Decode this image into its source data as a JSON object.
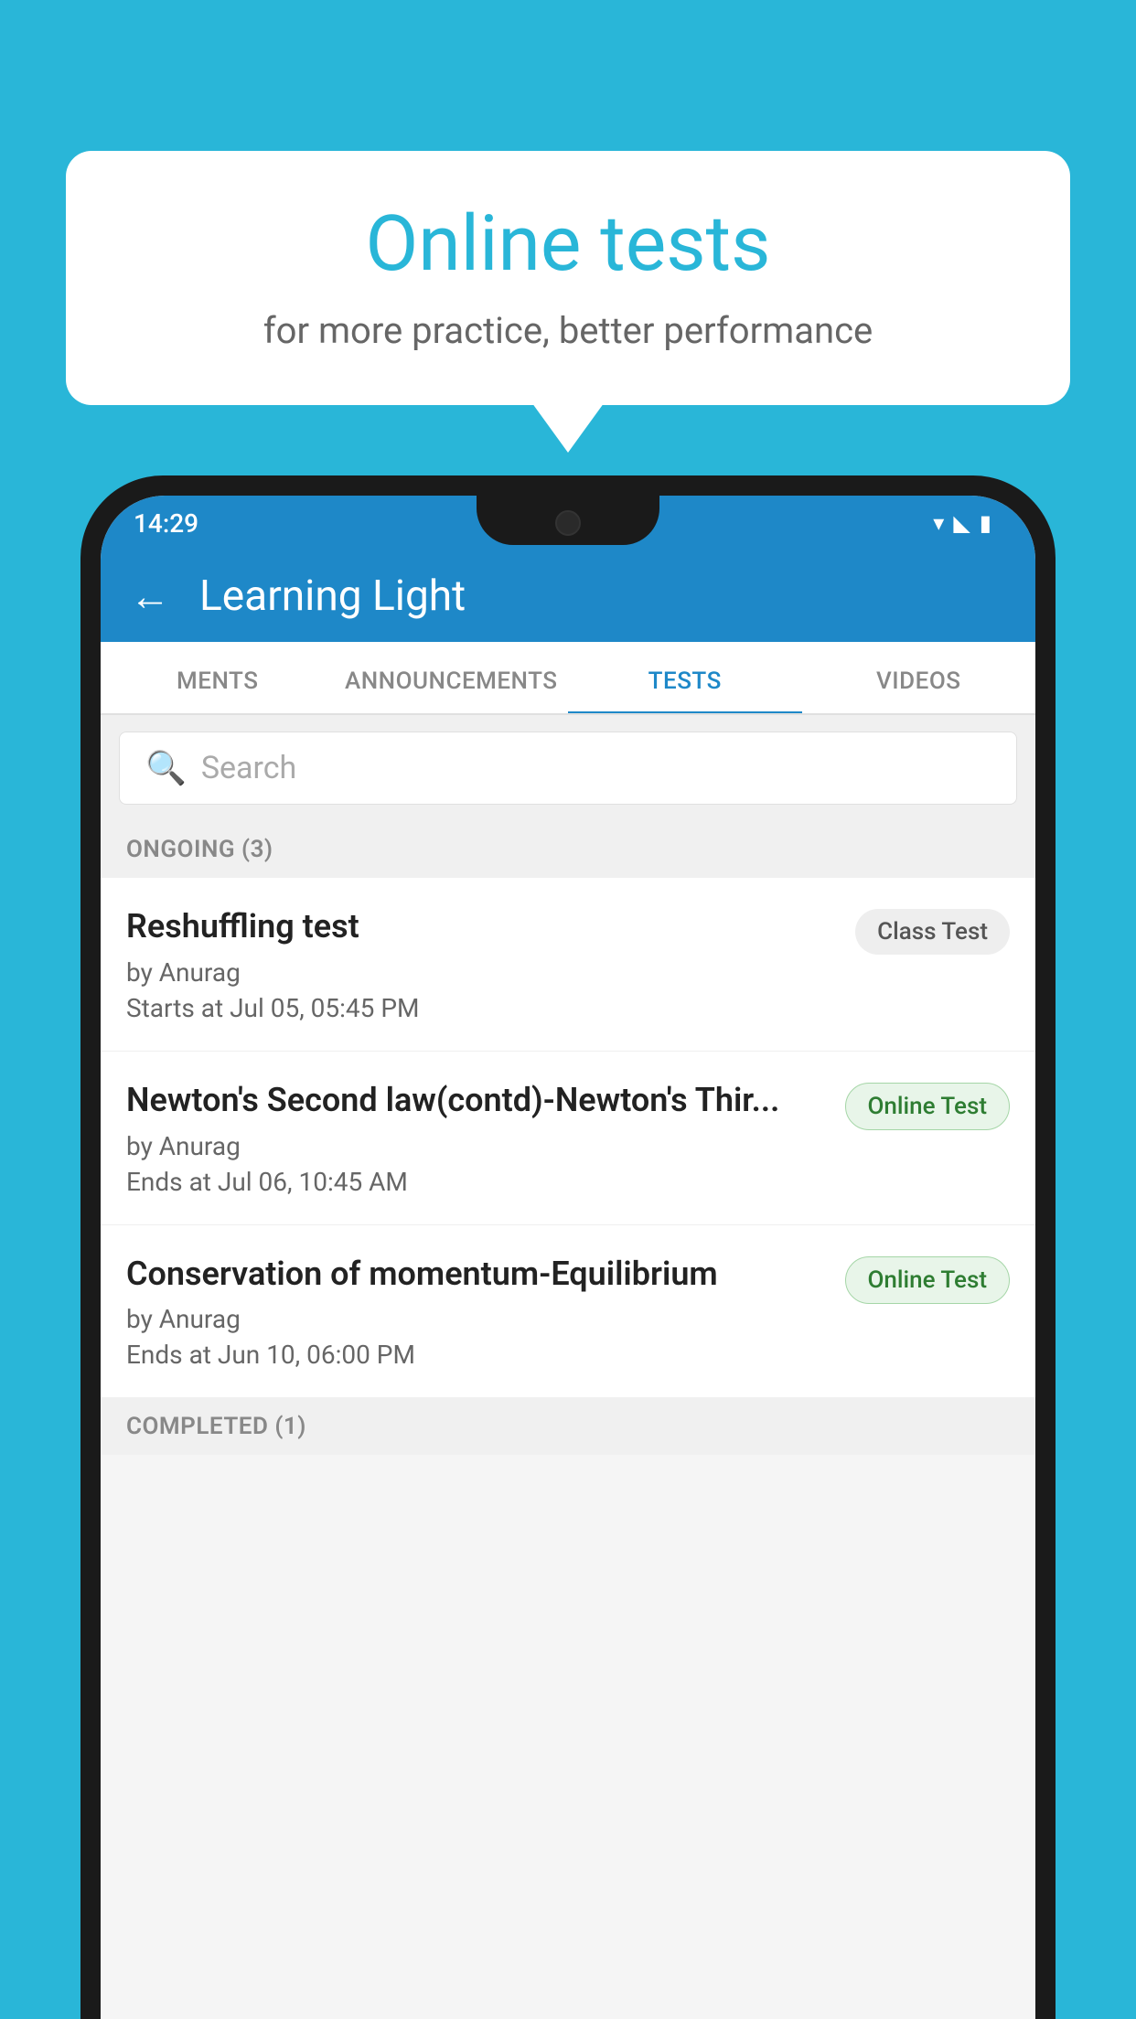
{
  "background": {
    "color": "#29b6d8"
  },
  "bubble": {
    "title": "Online tests",
    "subtitle": "for more practice, better performance"
  },
  "statusBar": {
    "time": "14:29",
    "wifi_icon": "▾",
    "signal_icon": "▴▴",
    "battery_icon": "▮"
  },
  "appBar": {
    "back_label": "←",
    "title": "Learning Light"
  },
  "tabs": [
    {
      "label": "MENTS",
      "active": false
    },
    {
      "label": "ANNOUNCEMENTS",
      "active": false
    },
    {
      "label": "TESTS",
      "active": true
    },
    {
      "label": "VIDEOS",
      "active": false
    }
  ],
  "search": {
    "placeholder": "Search"
  },
  "sections": {
    "ongoing": {
      "label": "ONGOING (3)",
      "tests": [
        {
          "name": "Reshuffling test",
          "author": "by Anurag",
          "time": "Starts at  Jul 05, 05:45 PM",
          "badge": "Class Test",
          "badge_type": "class"
        },
        {
          "name": "Newton's Second law(contd)-Newton's Thir...",
          "author": "by Anurag",
          "time": "Ends at  Jul 06, 10:45 AM",
          "badge": "Online Test",
          "badge_type": "online"
        },
        {
          "name": "Conservation of momentum-Equilibrium",
          "author": "by Anurag",
          "time": "Ends at  Jun 10, 06:00 PM",
          "badge": "Online Test",
          "badge_type": "online"
        }
      ]
    },
    "completed": {
      "label": "COMPLETED (1)"
    }
  }
}
